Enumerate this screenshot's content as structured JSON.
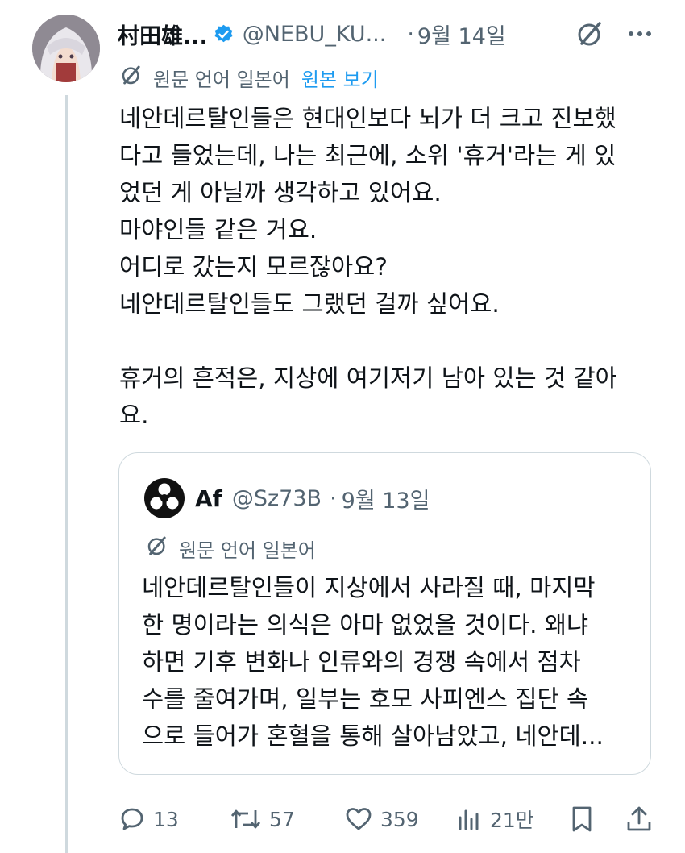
{
  "post": {
    "author_name": "村田雄...",
    "handle": "@NEBU_KU...",
    "separator": "·",
    "time": "9월 14일",
    "translated_from": "원문 언어 일본어",
    "show_original": "원본 보기",
    "lines": [
      "네안데르탈인들은 현대인보다 뇌가 더 크고 진보했",
      "다고 들었는데, 나는 최근에, 소위 '휴거'라는 게 있",
      "었던 게 아닐까 생각하고 있어요.",
      "마야인들 같은 거요.",
      "어디로 갔는지 모르잖아요?",
      "네안데르탈인들도 그랬던 걸까 싶어요.",
      "휴거의 흔적은, 지상에 여기저기 남아 있는 것 같아",
      "요."
    ]
  },
  "quote": {
    "author_name": "Af",
    "handle": "@Sz73B",
    "separator": "·",
    "time": "9월 13일",
    "translated_from": "원문 언어 일본어",
    "lines": [
      "네안데르탈인들이 지상에서 사라질 때, 마지막",
      "한 명이라는 의식은 아마 없었을 것이다. 왜냐",
      "하면 기후 변화나 인류와의 경쟁 속에서 점차",
      "수를 줄여가며, 일부는 호모 사피엔스 집단 속",
      "으로 들어가 혼혈을 통해 살아남았고, 네안데..."
    ]
  },
  "actions": {
    "replies": "13",
    "reposts": "57",
    "likes": "359",
    "views": "21만"
  },
  "icons": [
    "verified-badge-icon",
    "grok-icon",
    "more-icon",
    "translate-icon",
    "reply-icon",
    "repost-icon",
    "like-icon",
    "views-icon",
    "bookmark-icon",
    "share-icon"
  ],
  "colors": {
    "accent": "#1d9bf0",
    "secondary_text": "#536471",
    "border": "#cfd9de"
  }
}
